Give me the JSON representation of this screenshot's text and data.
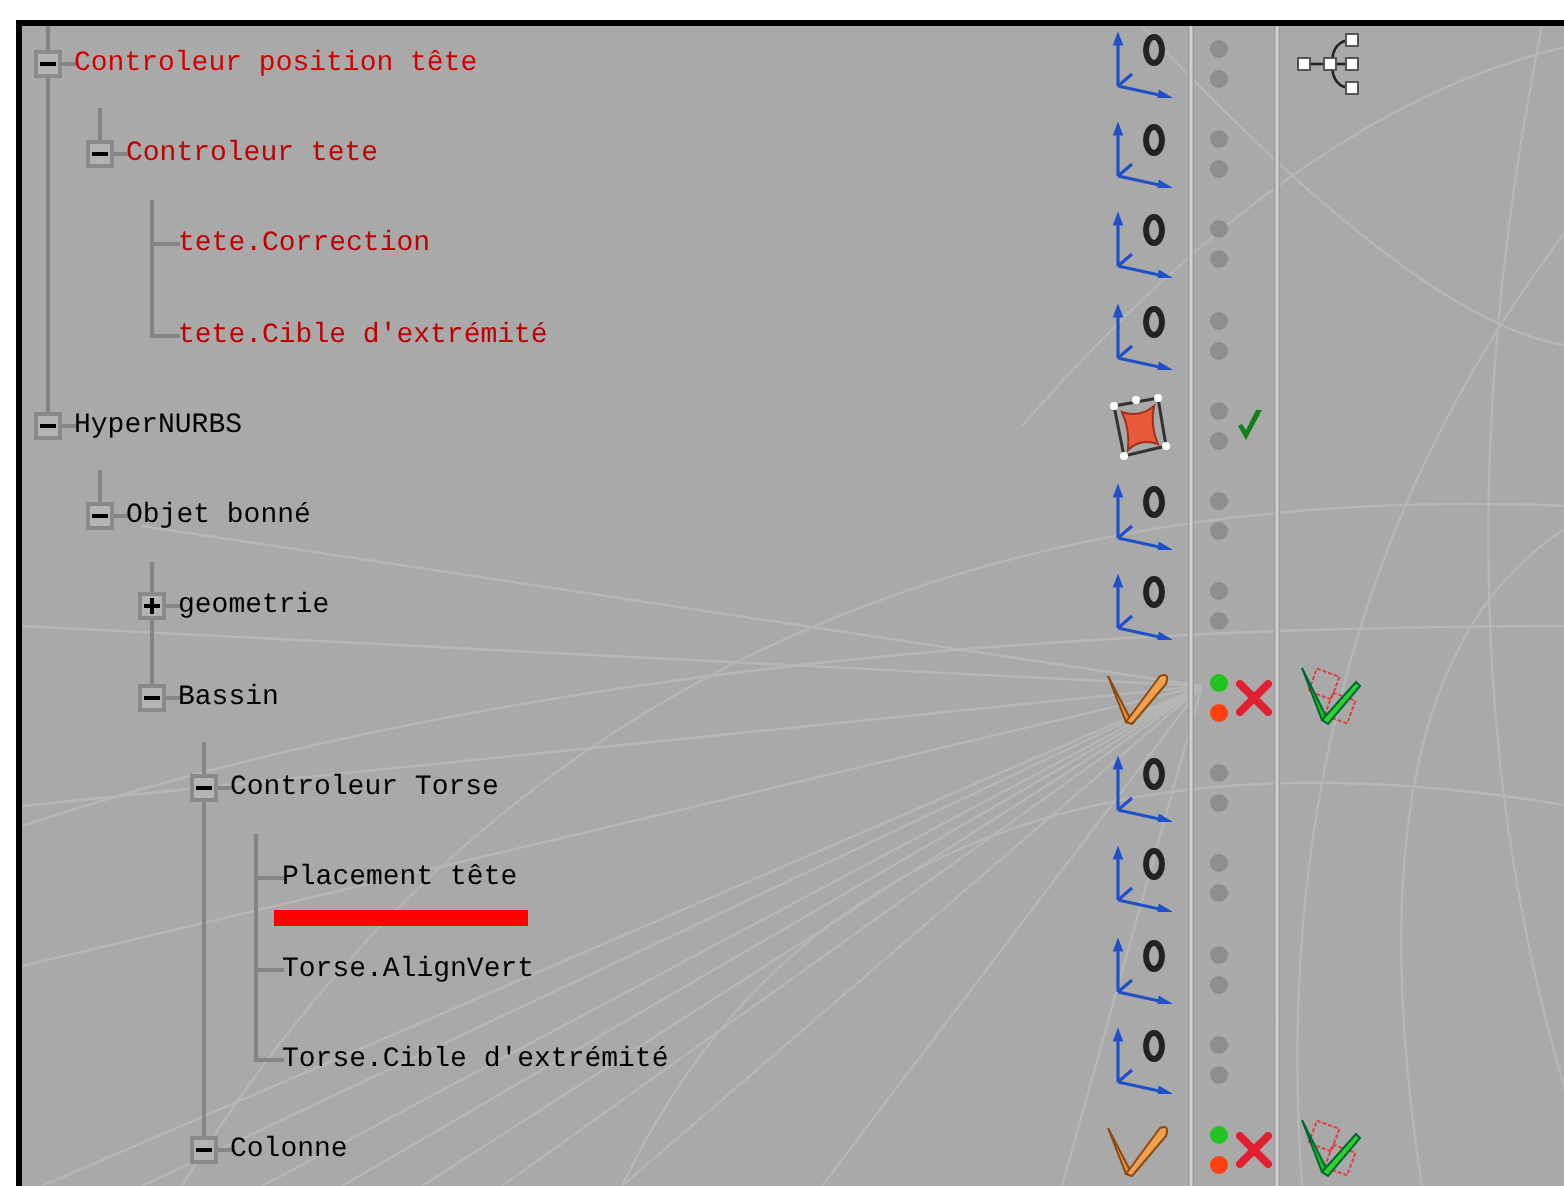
{
  "objects": [
    {
      "name": "Controleur position tête",
      "color": "#d40000",
      "expanded": true,
      "kind": "null",
      "visibility_set": false,
      "tag": {
        "kind": "hierarchy"
      },
      "children": [
        {
          "name": "Controleur tete",
          "color": "#c00000",
          "expanded": true,
          "kind": "null",
          "visibility_set": false,
          "children": [
            {
              "name": "tete.Correction",
              "color": "#c00000",
              "kind": "null",
              "visibility_set": false
            },
            {
              "name": "tete.Cible d'extrémité",
              "color": "#c00000",
              "kind": "null",
              "visibility_set": false
            }
          ]
        }
      ]
    },
    {
      "name": "HyperNURBS",
      "color": "#000000",
      "expanded": true,
      "kind": "hypernurbs",
      "visibility_set": false,
      "enabled": true,
      "children": [
        {
          "name": "Objet bonné",
          "color": "#000000",
          "expanded": true,
          "kind": "null",
          "visibility_set": false,
          "children": [
            {
              "name": "geometrie",
              "color": "#000000",
              "expanded": false,
              "kind": "null",
              "visibility_set": false
            },
            {
              "name": "Bassin",
              "color": "#000000",
              "expanded": true,
              "kind": "bone",
              "visibility_set": true,
              "enabled": false,
              "tag": {
                "kind": "ik"
              },
              "children": [
                {
                  "name": "Controleur Torse",
                  "color": "#000000",
                  "expanded": true,
                  "kind": "null",
                  "visibility_set": false,
                  "children": [
                    {
                      "name": "Placement tête",
                      "color": "#000000",
                      "underlined": true,
                      "kind": "null",
                      "visibility_set": false
                    },
                    {
                      "name": "Torse.AlignVert",
                      "color": "#000000",
                      "kind": "null",
                      "visibility_set": false
                    },
                    {
                      "name": "Torse.Cible d'extrémité",
                      "color": "#000000",
                      "kind": "null",
                      "visibility_set": false
                    }
                  ]
                },
                {
                  "name": "Colonne",
                  "color": "#000000",
                  "expanded": true,
                  "kind": "bone",
                  "visibility_set": true,
                  "enabled": false,
                  "tag": {
                    "kind": "ik"
                  }
                }
              ]
            }
          ]
        }
      ]
    }
  ]
}
